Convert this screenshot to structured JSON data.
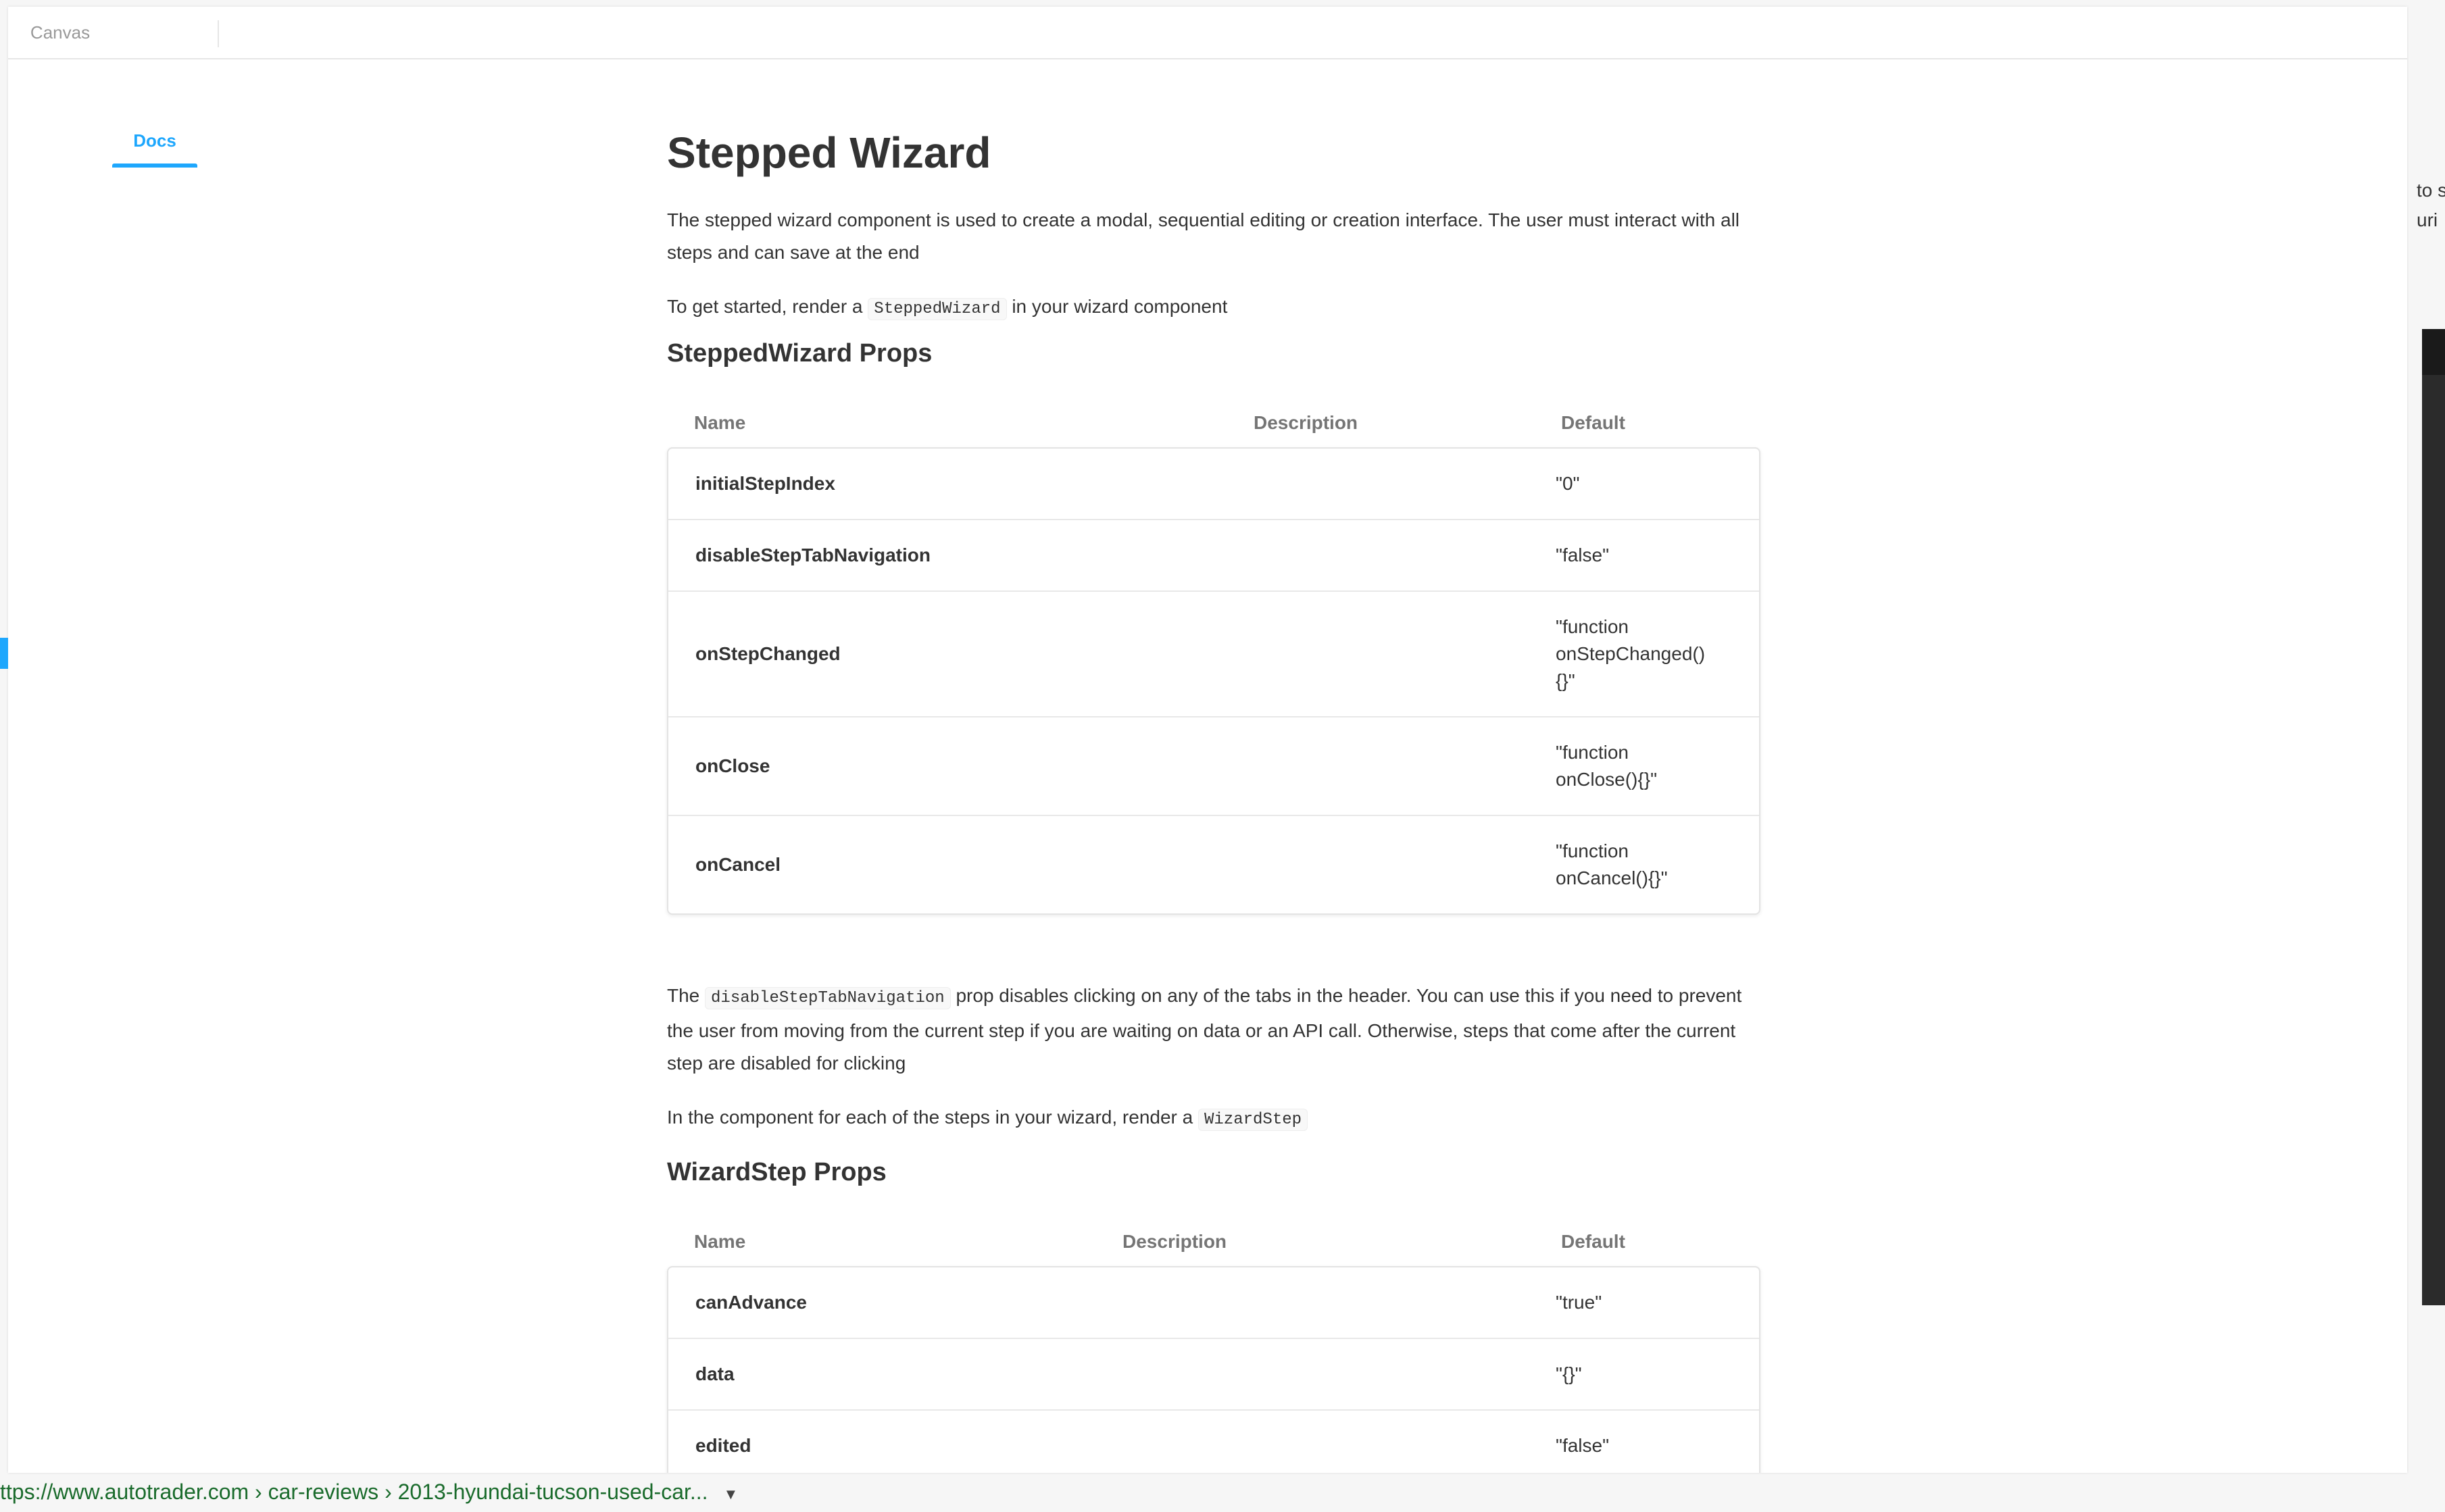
{
  "tabs": {
    "canvas": "Canvas",
    "docs": "Docs"
  },
  "doc": {
    "title": "Stepped Wizard",
    "intro": "The stepped wizard component is used to create a modal, sequential editing or creation interface. The user must interact with all steps and can save at the end",
    "get_started": {
      "before": "To get started, render a",
      "code": "SteppedWizard",
      "after": "in your wizard component"
    },
    "stepped_wizard_props": {
      "heading": "SteppedWizard Props",
      "columns": {
        "name": "Name",
        "description": "Description",
        "default": "Default"
      },
      "rows": [
        {
          "name": "initialStepIndex",
          "default": "\"0\""
        },
        {
          "name": "disableStepTabNavigation",
          "default": "\"false\""
        },
        {
          "name": "onStepChanged",
          "default": "\"function\nonStepChanged()\n{}\""
        },
        {
          "name": "onClose",
          "default": "\"function\nonClose(){}\""
        },
        {
          "name": "onCancel",
          "default": "\"function\nonCancel(){}\""
        }
      ]
    },
    "disable_note": {
      "before": "The",
      "code": "disableStepTabNavigation",
      "after": "prop disables clicking on any of the tabs in the header. You can use this if you need to prevent the user from moving from the current step if you are waiting on data or an API call. Otherwise, steps that come after the current step are disabled for clicking"
    },
    "wizard_step_note": {
      "before": "In the component for each of the steps in your wizard, render a",
      "code": "WizardStep"
    },
    "wizard_step_props": {
      "heading": "WizardStep Props",
      "columns": {
        "name": "Name",
        "description": "Description",
        "default": "Default"
      },
      "rows": [
        {
          "name": "canAdvance",
          "default": "\"true\""
        },
        {
          "name": "data",
          "default": "\"{}\""
        },
        {
          "name": "edited",
          "default": "\"false\""
        }
      ]
    }
  },
  "status_bar": {
    "url": "ttps://www.autotrader.com › car-reviews › 2013-hyundai-tucson-used-car..."
  },
  "right_edge": {
    "line1": "to s",
    "line2": "uri"
  },
  "colors": {
    "accent": "#1ea7fd",
    "url_green": "#1a6b2c"
  },
  "icons": {
    "status_caret": "caret-down-icon"
  }
}
